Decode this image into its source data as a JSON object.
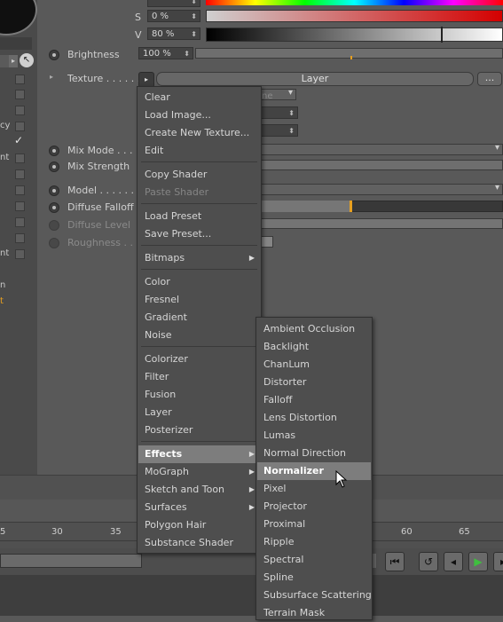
{
  "color_fields": {
    "s_label": "S",
    "s_value": "0 %",
    "v_label": "V",
    "v_value": "80 %"
  },
  "brightness": {
    "label": "Brightness",
    "value": "100 %"
  },
  "texture": {
    "label": "Texture . . . . . .",
    "layer_button": "Layer",
    "more_button": "..."
  },
  "hidden_field_text": "ne",
  "mix_mode": {
    "label": "Mix Mode . . . ."
  },
  "mix_strength": {
    "label": "Mix Strength"
  },
  "model": {
    "label": "Model . . . . . . ."
  },
  "diffuse_falloff": {
    "label": "Diffuse Falloff"
  },
  "diffuse_level": {
    "label": "Diffuse Level"
  },
  "roughness": {
    "label": "Roughness . . ."
  },
  "left_strip_labels": [
    "cy",
    "nt",
    "nt",
    "n",
    "t"
  ],
  "context_menu": {
    "groups": [
      [
        "Clear",
        "Load Image...",
        "Create New Texture...",
        "Edit"
      ],
      [
        "Copy Shader",
        "Paste Shader"
      ],
      [
        "Load Preset",
        "Save Preset..."
      ],
      [
        "Bitmaps"
      ],
      [
        "Color",
        "Fresnel",
        "Gradient",
        "Noise"
      ],
      [
        "Colorizer",
        "Filter",
        "Fusion",
        "Layer",
        "Posterizer"
      ],
      [
        "Effects",
        "MoGraph",
        "Sketch and Toon",
        "Surfaces",
        "Polygon Hair",
        "Substance Shader"
      ]
    ]
  },
  "effects_submenu": {
    "items": [
      "Ambient Occlusion",
      "Backlight",
      "ChanLum",
      "Distorter",
      "Falloff",
      "Lens Distortion",
      "Lumas",
      "Normal Direction",
      "Normalizer",
      "Pixel",
      "Projector",
      "Proximal",
      "Ripple",
      "Spectral",
      "Spline",
      "Subsurface Scattering",
      "Terrain Mask"
    ],
    "highlighted": "Normalizer"
  },
  "timeline": {
    "ticks": [
      "5",
      "30",
      "35",
      "60",
      "65"
    ]
  },
  "colors": {
    "accent_marker": "#e8a020",
    "menu_bg": "#4e4e4e",
    "menu_highlight": "#7d7d7d",
    "play_green": "#3fbf3f"
  }
}
